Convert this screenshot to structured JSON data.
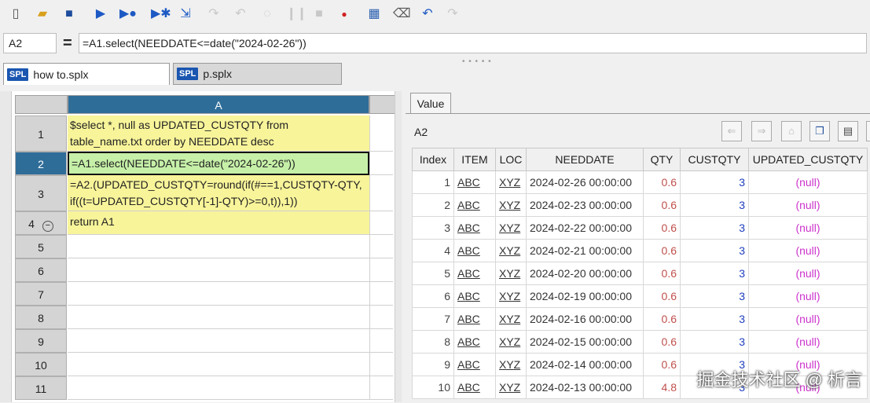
{
  "toolbar": {
    "icons": [
      "new-file-icon",
      "open-folder-icon",
      "save-icon",
      "run-icon",
      "run-to-cursor-icon",
      "debug-icon",
      "step-into-icon",
      "step-over-icon",
      "step-out-icon",
      "pause-icon",
      "stop-icon",
      "breakpoint-icon",
      "calculator-icon",
      "clear-icon",
      "undo-icon",
      "redo-icon"
    ]
  },
  "formula_bar": {
    "cell_ref": "A2",
    "equals": "=",
    "formula": "=A1.select(NEEDDATE<=date(\"2024-02-26\"))"
  },
  "file_tabs": [
    {
      "badge": "SPL",
      "label": "how to.splx"
    },
    {
      "badge": "SPL",
      "label": "p.splx"
    }
  ],
  "grid": {
    "col_header": "A",
    "rows": [
      {
        "num": "1",
        "line1": "$select *,  null as UPDATED_CUSTQTY from",
        "line2": "table_name.txt order by NEEDDATE desc"
      },
      {
        "num": "2",
        "line1": "=A1.select(NEEDDATE<=date(\"2024-02-26\"))",
        "line2": ""
      },
      {
        "num": "3",
        "line1": "=A2.(UPDATED_CUSTQTY=round(if(#==1,CUSTQTY-QTY,",
        "line2": "if((t=UPDATED_CUSTQTY[-1]-QTY)>=0,t)),1))"
      },
      {
        "num": "4",
        "line1": "return A1",
        "line2": ""
      },
      {
        "num": "5"
      },
      {
        "num": "6"
      },
      {
        "num": "7"
      },
      {
        "num": "8"
      },
      {
        "num": "9"
      },
      {
        "num": "10"
      },
      {
        "num": "11"
      }
    ]
  },
  "value_panel": {
    "tab_label": "Value",
    "cell_label": "A2",
    "columns": [
      "Index",
      "ITEM",
      "LOC",
      "NEEDDATE",
      "QTY",
      "CUSTQTY",
      "UPDATED_CUSTQTY"
    ],
    "rows": [
      [
        "1",
        "ABC",
        "XYZ",
        "2024-02-26 00:00:00",
        "0.6",
        "3",
        "(null)"
      ],
      [
        "2",
        "ABC",
        "XYZ",
        "2024-02-23 00:00:00",
        "0.6",
        "3",
        "(null)"
      ],
      [
        "3",
        "ABC",
        "XYZ",
        "2024-02-22 00:00:00",
        "0.6",
        "3",
        "(null)"
      ],
      [
        "4",
        "ABC",
        "XYZ",
        "2024-02-21 00:00:00",
        "0.6",
        "3",
        "(null)"
      ],
      [
        "5",
        "ABC",
        "XYZ",
        "2024-02-20 00:00:00",
        "0.6",
        "3",
        "(null)"
      ],
      [
        "6",
        "ABC",
        "XYZ",
        "2024-02-19 00:00:00",
        "0.6",
        "3",
        "(null)"
      ],
      [
        "7",
        "ABC",
        "XYZ",
        "2024-02-16 00:00:00",
        "0.6",
        "3",
        "(null)"
      ],
      [
        "8",
        "ABC",
        "XYZ",
        "2024-02-15 00:00:00",
        "0.6",
        "3",
        "(null)"
      ],
      [
        "9",
        "ABC",
        "XYZ",
        "2024-02-14 00:00:00",
        "0.6",
        "3",
        "(null)"
      ],
      [
        "10",
        "ABC",
        "XYZ",
        "2024-02-13 00:00:00",
        "4.8",
        "3",
        "(null)"
      ]
    ]
  },
  "watermark": "掘金技术社区 @ 析言",
  "colors": {
    "qty": "#c0504d",
    "custqty": "#1f3fbf",
    "null": "#cc33cc",
    "selected_row_cell": "#c6f0a8",
    "code_cell": "#f8f49a",
    "header_blue": "#2f6d99"
  }
}
